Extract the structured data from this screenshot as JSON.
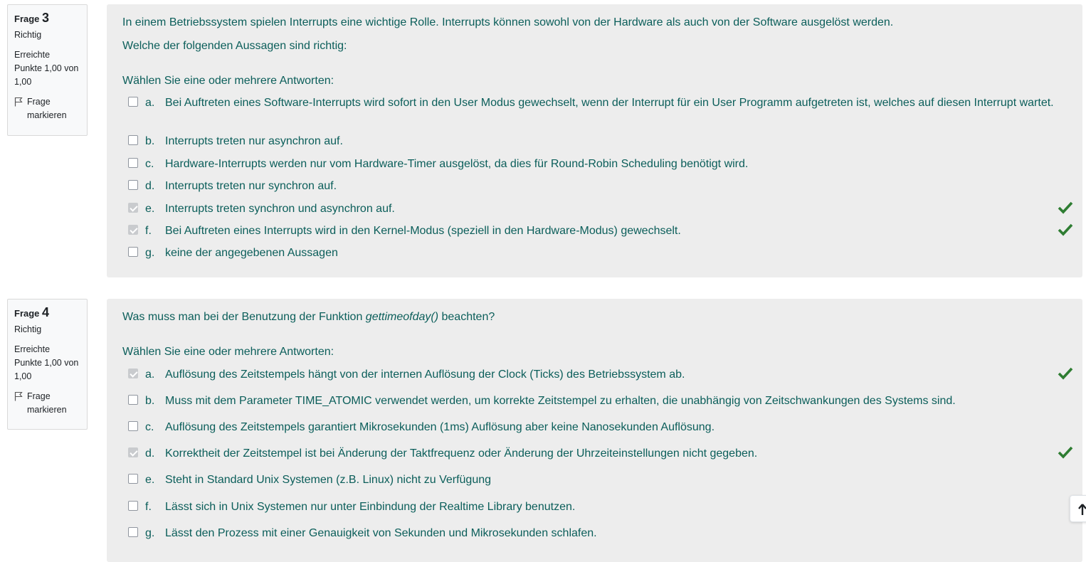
{
  "colors": {
    "text_accent": "#0b5e5a",
    "correct_tick": "#2e7d32",
    "content_bg": "#ededed"
  },
  "questions": [
    {
      "label": "Frage",
      "number": "3",
      "state": "Richtig",
      "grade_line1": "Erreichte",
      "grade_line2": "Punkte 1,00 von",
      "grade_line3": "1,00",
      "flag_label_1": "Frage",
      "flag_label_2": "markieren",
      "text_1": "In einem Betriebssystem spielen Interrupts eine wichtige Rolle. Interrupts können sowohl von der Hardware als auch von der Software ausgelöst werden.",
      "text_2": "Welche der folgenden Aussagen sind richtig:",
      "prompt": "Wählen Sie eine oder mehrere Antworten:",
      "answers": [
        {
          "letter": "a.",
          "text": "Bei Auftreten eines Software-Interrupts wird sofort in den User Modus gewechselt, wenn der Interrupt für ein User Programm aufgetreten ist, welches auf diesen Interrupt wartet.",
          "checked": false
        },
        {
          "letter": "b.",
          "text": "Interrupts treten nur asynchron auf.",
          "checked": false
        },
        {
          "letter": "c.",
          "text": "Hardware-Interrupts werden nur vom Hardware-Timer ausgelöst, da dies für Round-Robin Scheduling benötigt wird.",
          "checked": false
        },
        {
          "letter": "d.",
          "text": "Interrupts treten nur synchron auf.",
          "checked": false
        },
        {
          "letter": "e.",
          "text": "Interrupts treten synchron und asynchron auf.",
          "checked": true
        },
        {
          "letter": "f.",
          "text": "Bei Auftreten eines Interrupts wird in den Kernel-Modus (speziell in den Hardware-Modus) gewechselt.",
          "checked": true
        },
        {
          "letter": "g.",
          "text": "keine der angegebenen Aussagen",
          "checked": false
        }
      ]
    },
    {
      "label": "Frage",
      "number": "4",
      "state": "Richtig",
      "grade_line1": "Erreichte",
      "grade_line2": "Punkte 1,00 von",
      "grade_line3": "1,00",
      "flag_label_1": "Frage",
      "flag_label_2": "markieren",
      "text_pre": "Was muss man bei der Benutzung der Funktion ",
      "text_func": "gettimeofday()",
      "text_post": " beachten?",
      "prompt": "Wählen Sie eine oder mehrere Antworten:",
      "answers": [
        {
          "letter": "a.",
          "text": "Auflösung des Zeitstempels hängt von der internen Auflösung der Clock (Ticks) des Betriebssystem ab.",
          "checked": true
        },
        {
          "letter": "b.",
          "text": "Muss mit dem Parameter TIME_ATOMIC verwendet werden, um korrekte Zeitstempel zu erhalten, die unabhängig von Zeitschwankungen des Systems sind.",
          "checked": false
        },
        {
          "letter": "c.",
          "text": "Auflösung des Zeitstempels garantiert Mikrosekunden (1ms) Auflösung aber keine Nanosekunden Auflösung.",
          "checked": false
        },
        {
          "letter": "d.",
          "text": "Korrektheit der Zeitstempel ist bei Änderung der Taktfrequenz oder Änderung der Uhrzeiteinstellungen nicht gegeben.",
          "checked": true
        },
        {
          "letter": "e.",
          "text": "Steht in Standard Unix Systemen (z.B. Linux) nicht zu Verfügung",
          "checked": false
        },
        {
          "letter": "f.",
          "text": "Lässt sich in Unix Systemen nur unter Einbindung der Realtime Library benutzen.",
          "checked": false
        },
        {
          "letter": "g.",
          "text": "Lässt den Prozess mit einer Genauigkeit von Sekunden und Mikrosekunden schlafen.",
          "checked": false
        }
      ]
    }
  ]
}
